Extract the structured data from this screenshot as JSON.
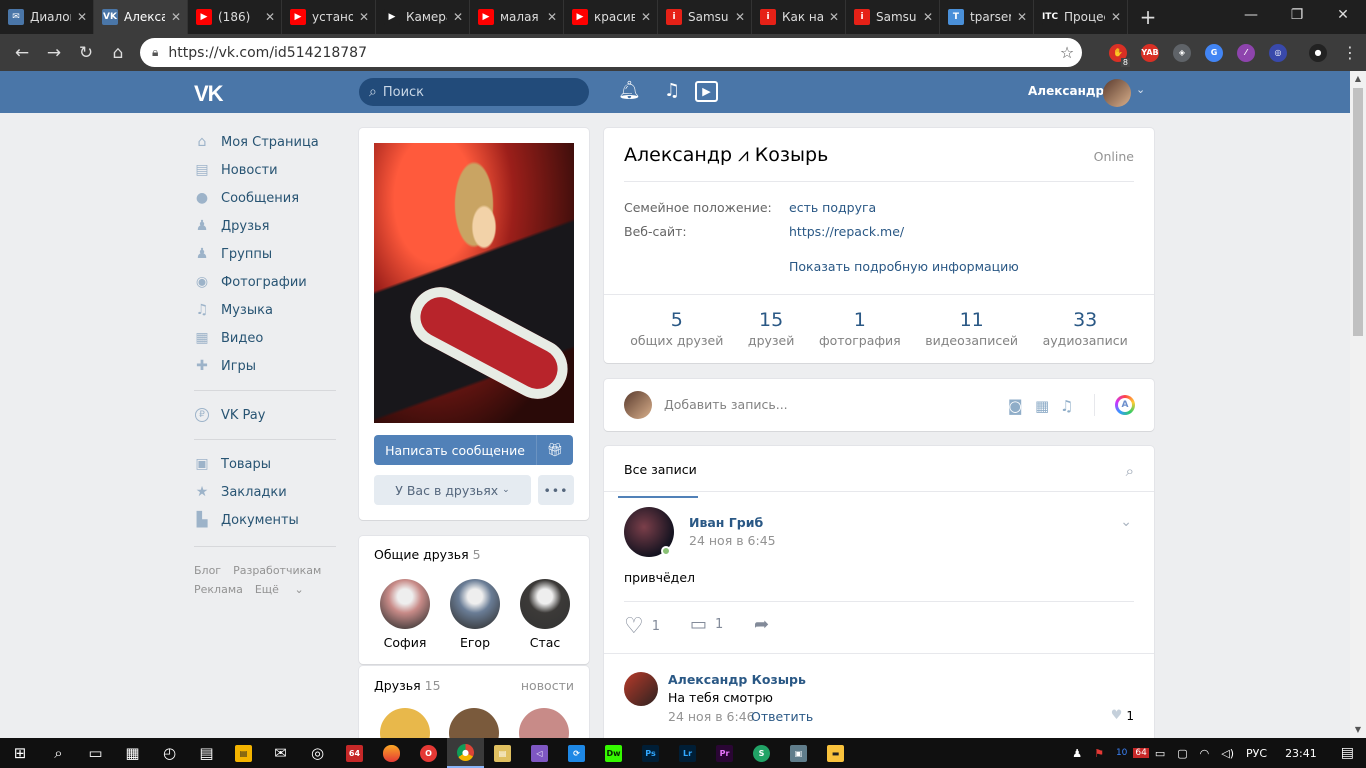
{
  "browser": {
    "tabs": [
      {
        "title": "Диалоги",
        "color": "#4a76a8",
        "glyph": "✉"
      },
      {
        "title": "Александр",
        "color": "#4a76a8",
        "glyph": "VK",
        "active": true
      },
      {
        "title": "(186)",
        "color": "#ff0000",
        "glyph": "▶"
      },
      {
        "title": "установка",
        "color": "#ff0000",
        "glyph": "▶"
      },
      {
        "title": "Камера",
        "color": "#1f1f1f",
        "glyph": "▶"
      },
      {
        "title": "малая",
        "color": "#ff0000",
        "glyph": "▶"
      },
      {
        "title": "красивые",
        "color": "#ff0000",
        "glyph": "▶"
      },
      {
        "title": "Samsung",
        "color": "#e62117",
        "glyph": "i"
      },
      {
        "title": "Как на",
        "color": "#e62117",
        "glyph": "i"
      },
      {
        "title": "Samsung",
        "color": "#e62117",
        "glyph": "i"
      },
      {
        "title": "tparser",
        "color": "#4a90d9",
        "glyph": "T"
      },
      {
        "title": "Процессор",
        "color": "#1f1f1f",
        "glyph": "ITC"
      }
    ],
    "url": "https://vk.com/id514218787",
    "ext_badge": "8"
  },
  "vk_header": {
    "search_placeholder": "Поиск",
    "user_name": "Александр"
  },
  "menu": {
    "items": [
      {
        "label": "Моя Страница",
        "icon": "home-icon",
        "glyph": "⌂"
      },
      {
        "label": "Новости",
        "icon": "news-icon",
        "glyph": "▤"
      },
      {
        "label": "Сообщения",
        "icon": "messages-icon",
        "glyph": "●"
      },
      {
        "label": "Друзья",
        "icon": "friends-icon",
        "glyph": "♟"
      },
      {
        "label": "Группы",
        "icon": "groups-icon",
        "glyph": "♟"
      },
      {
        "label": "Фотографии",
        "icon": "camera-icon",
        "glyph": "◉"
      },
      {
        "label": "Музыка",
        "icon": "music-icon",
        "glyph": "♫"
      },
      {
        "label": "Видео",
        "icon": "video-icon",
        "glyph": "▦"
      },
      {
        "label": "Игры",
        "icon": "games-icon",
        "glyph": "✚"
      }
    ],
    "pay": {
      "label": "VK Pay",
      "glyph": "₽"
    },
    "items2": [
      {
        "label": "Товары",
        "icon": "goods-icon",
        "glyph": "▣"
      },
      {
        "label": "Закладки",
        "icon": "bookmark-icon",
        "glyph": "★"
      },
      {
        "label": "Документы",
        "icon": "documents-icon",
        "glyph": "▙"
      }
    ],
    "footer": {
      "blog": "Блог",
      "dev": "Разработчикам",
      "ads": "Реклама",
      "more": "Ещё"
    }
  },
  "profile_card": {
    "write_message": "Написать сообщение",
    "in_friends": "У Вас в друзьях",
    "more": "•••"
  },
  "mutual_friends": {
    "title": "Общие друзья",
    "count": "5",
    "items": [
      {
        "name": "София",
        "color": "#c88b88"
      },
      {
        "name": "Егор",
        "color": "#6a7d96"
      },
      {
        "name": "Стас",
        "color": "#3c3a38"
      }
    ]
  },
  "friends": {
    "title": "Друзья",
    "count": "15",
    "news_link": "новости"
  },
  "profile": {
    "name": "Александр ⩘ Козырь",
    "status": "Online",
    "info": [
      {
        "key": "Семейное положение:",
        "value": "есть подруга"
      },
      {
        "key": "Веб-сайт:",
        "value": "https://repack.me/"
      }
    ],
    "show_more": "Показать подробную информацию",
    "counters": [
      {
        "value": "5",
        "label": "общих друзей"
      },
      {
        "value": "15",
        "label": "друзей"
      },
      {
        "value": "1",
        "label": "фотография"
      },
      {
        "value": "11",
        "label": "видеозаписей"
      },
      {
        "value": "33",
        "label": "аудиозаписи"
      }
    ]
  },
  "composer": {
    "placeholder": "Добавить запись..."
  },
  "wall": {
    "tab": "Все записи",
    "post": {
      "author": "Иван Гриб",
      "date": "24 ноя в 6:45",
      "text": "привчёдел",
      "likes": "1",
      "comments": "1"
    },
    "comment": {
      "author": "Александр Козырь",
      "text": "На тебя смотрю",
      "date": "24 ноя в 6:46",
      "reply": "Ответить",
      "likes": "1"
    }
  },
  "taskbar": {
    "lang": "РУС",
    "time": "23:41",
    "badge_64": "64",
    "badge_10": "10"
  }
}
